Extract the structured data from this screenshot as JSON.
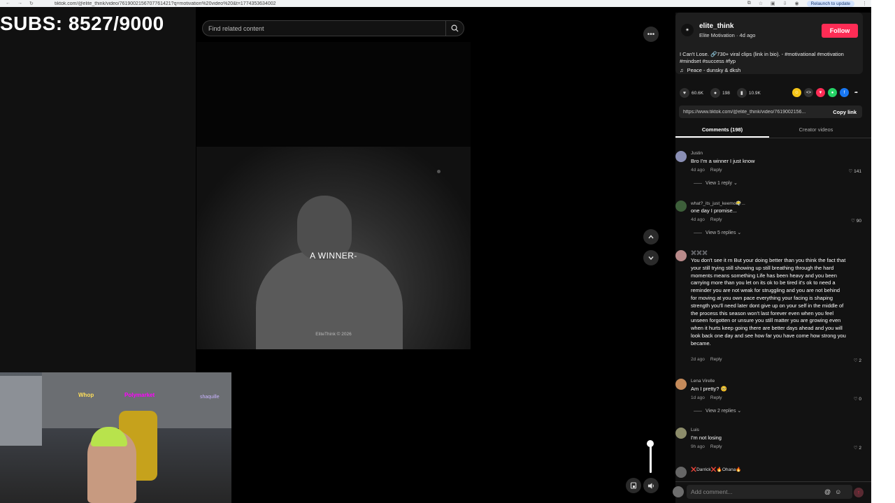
{
  "browser": {
    "url": "tiktok.com/@elite_think/video/7619002156707761421?q=motivation%20video%20&t=1774353634002",
    "relaunch_label": "Relaunch to update"
  },
  "overlay": {
    "subs_text": "SUBS: 8527/9000"
  },
  "search": {
    "placeholder": "Find related content"
  },
  "video": {
    "caption": "A WINNER-",
    "watermark": "EliteThink © 2026"
  },
  "webcam": {
    "sign1": "Whop",
    "sign2": "Polymarket",
    "sign3": "shaquille"
  },
  "creator": {
    "username": "elite_think",
    "display": "Elite Motivation · 4d ago",
    "follow_label": "Follow",
    "description": "I Can't Lose. 🔗730+ viral clips (link in bio). - #motivational #motivation #mindset #success #fyp",
    "music": "Peace - dunsky & dksh"
  },
  "stats": {
    "likes": "60.6K",
    "comments": "198",
    "saves": "10.9K"
  },
  "link": {
    "url": "https://www.tiktok.com/@elite_think/video/7619002156...",
    "copy_label": "Copy link"
  },
  "tabs": {
    "comments": "Comments (198)",
    "creator_videos": "Creator videos"
  },
  "comments": [
    {
      "user": "Justin",
      "text": "Bro I'm a winner I just know",
      "time": "4d ago",
      "reply": "Reply",
      "likes": "141",
      "view_replies": "View 1 reply"
    },
    {
      "user": "what?_its_just_keemo😶‍🌫️...",
      "text": "one day I promise...",
      "time": "4d ago",
      "reply": "Reply",
      "likes": "90",
      "view_replies": "View 5 replies"
    },
    {
      "user": "✖️✖️✖️",
      "text": "You don't see it rn But your doing better than you think the fact that your still trying still showing up still breathing through the hard moments means something Life has been heavy and you been carrying more than you let on its ok to be tired it's ok to need a reminder you are not weak for struggling and you are not behind for moving at you own pace everything your facing is shaping strength you'll need later dont give up on your self in the middle of the process this season won't last forever even when you feel unseen forgotten or unsure you still matter you are growing even when it hurts keep going there are better days ahead and you will look back one day and see how far you have come how strong you became.",
      "time": "2d ago",
      "reply": "Reply",
      "likes": "2"
    },
    {
      "user": "Lena Virelle",
      "text": "Am I pretty? 🥺",
      "time": "1d ago",
      "reply": "Reply",
      "likes": "0",
      "view_replies": "View 2 replies"
    },
    {
      "user": "Luis",
      "text": "I'm not losing",
      "time": "9h ago",
      "reply": "Reply",
      "likes": "2"
    },
    {
      "user": "❌Darrick❌🔥Ohana🔥"
    }
  ],
  "comment_input": {
    "placeholder": "Add comment..."
  }
}
